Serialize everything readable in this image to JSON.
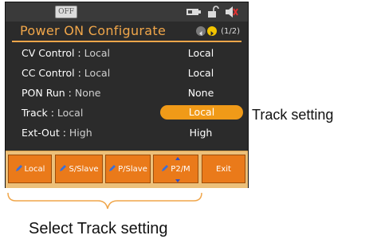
{
  "status": {
    "output_state": "OFF",
    "icons": [
      "battery-icon",
      "unlock-icon",
      "mute-icon"
    ]
  },
  "header": {
    "title": "Power  ON  Configurate",
    "page_indicator": "(1/2)"
  },
  "settings": [
    {
      "name": "CV  Control",
      "sep": " : ",
      "current": "Local",
      "value": "Local",
      "selected": false
    },
    {
      "name": "CC  Control",
      "sep": " : ",
      "current": "Local",
      "value": "Local",
      "selected": false
    },
    {
      "name": "PON  Run",
      "sep": " : ",
      "current": "None",
      "value": "None",
      "selected": false
    },
    {
      "name": "Track",
      "sep": " : ",
      "current": "Local",
      "value": "Local",
      "selected": true
    },
    {
      "name": "Ext-Out",
      "sep": " : ",
      "current": "High",
      "value": "High",
      "selected": false
    }
  ],
  "softkeys": [
    {
      "label": "Local",
      "icon": "pencil-icon"
    },
    {
      "label": "S/Slave",
      "icon": "pencil-icon"
    },
    {
      "label": "P/Slave",
      "icon": "pencil-icon"
    },
    {
      "label": "P2/M",
      "icon": "pencil-icon"
    },
    {
      "label": "Exit",
      "icon": ""
    }
  ],
  "annotations": {
    "side_label": "Track setting",
    "bottom_caption": "Select Track setting"
  },
  "colors": {
    "accent": "#f0a64a",
    "selected": "#f09a18",
    "key": "#ea7a1a",
    "screen_bg": "#2b2b2b"
  }
}
